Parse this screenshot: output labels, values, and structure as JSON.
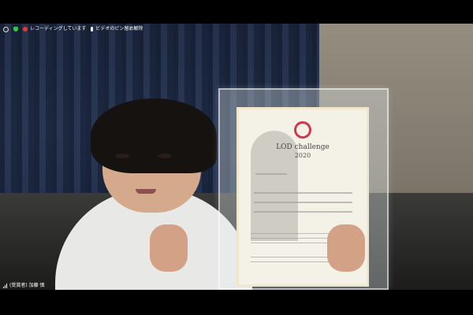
{
  "topbar": {
    "items": [
      {
        "icon": "info-icon",
        "label": ""
      },
      {
        "icon": "shield-icon",
        "label": ""
      },
      {
        "icon": "recording-icon",
        "label": "レコーディングしています"
      },
      {
        "icon": "mic-icon",
        "label": "ビデオのピン留め解除"
      }
    ]
  },
  "certificate": {
    "title": "LOD challenge",
    "year": "2020"
  },
  "bottombar": {
    "participant_name": "(受賞者) 加藤 慎"
  }
}
